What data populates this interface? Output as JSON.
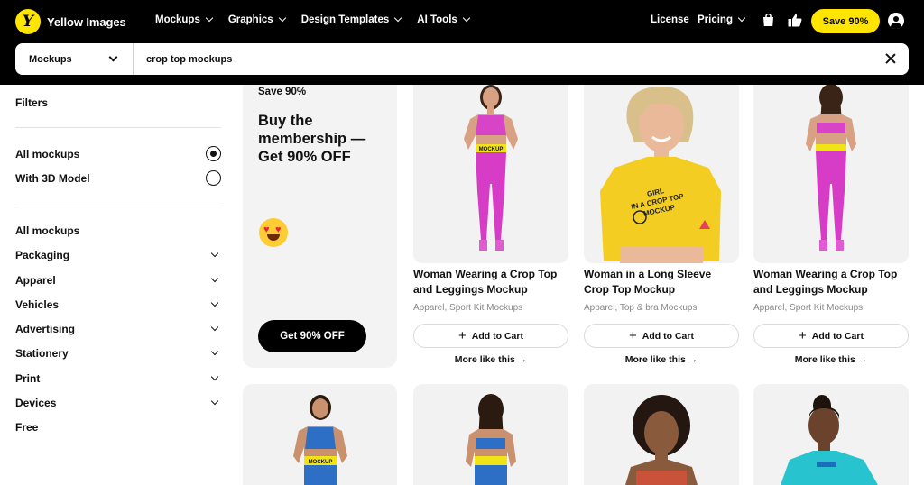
{
  "header": {
    "logo_mark": "Y",
    "brand": "Yellow Images",
    "nav": [
      "Mockups",
      "Graphics",
      "Design Templates",
      "AI Tools"
    ],
    "license": "License",
    "pricing": "Pricing",
    "save_label": "Save 90%",
    "icons": [
      "bag-icon",
      "thumbs-up-icon",
      "user-icon"
    ]
  },
  "search": {
    "category": "Mockups",
    "query": "crop top mockups"
  },
  "sidebar": {
    "filters_title": "Filters",
    "radio_options": [
      {
        "label": "All mockups",
        "selected": true
      },
      {
        "label": "With 3D Model",
        "selected": false
      }
    ],
    "categories": [
      {
        "label": "All mockups",
        "expandable": false
      },
      {
        "label": "Packaging",
        "expandable": true
      },
      {
        "label": "Apparel",
        "expandable": true
      },
      {
        "label": "Vehicles",
        "expandable": true
      },
      {
        "label": "Advertising",
        "expandable": true
      },
      {
        "label": "Stationery",
        "expandable": true
      },
      {
        "label": "Print",
        "expandable": true
      },
      {
        "label": "Devices",
        "expandable": true
      },
      {
        "label": "Free",
        "expandable": false
      }
    ]
  },
  "promo": {
    "kicker": "Save 90%",
    "title": "Buy the membership — Get 90% OFF",
    "emoji": "heart-eyes-emoji",
    "button": "Get 90% OFF"
  },
  "products": [
    {
      "title": "Woman Wearing a Crop Top and Leggings Mockup",
      "tags": "Apparel, Sport Kit Mockups",
      "cart": "Add to Cart",
      "more": "More like this"
    },
    {
      "title": "Woman in a Long Sleeve Crop Top Mockup",
      "tags": "Apparel, Top & bra Mockups",
      "cart": "Add to Cart",
      "more": "More like this"
    },
    {
      "title": "Woman Wearing a Crop Top and Leggings Mockup",
      "tags": "Apparel, Sport Kit Mockups",
      "cart": "Add to Cart",
      "more": "More like this"
    }
  ],
  "colors": {
    "accent": "#ffe500",
    "header_bg": "#000000",
    "card_bg": "#f2f2f2",
    "muted_text": "#888888"
  }
}
